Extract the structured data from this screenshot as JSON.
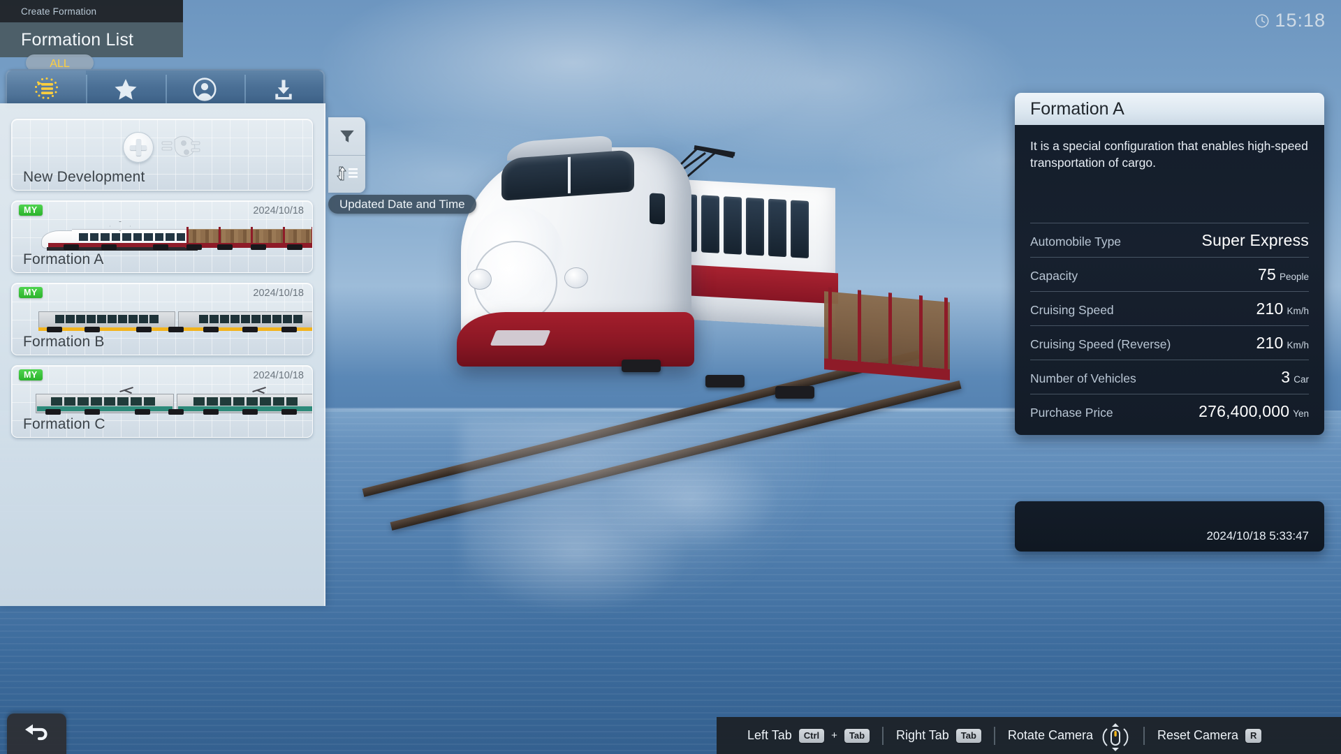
{
  "header": {
    "breadcrumb": "Create Formation",
    "title": "Formation List"
  },
  "clock": {
    "icon": "clock-icon",
    "time": "15:18"
  },
  "tabs": {
    "active_pill": "ALL",
    "items": [
      {
        "icon": "list-all-icon",
        "name": "tab-all",
        "active": true
      },
      {
        "icon": "star-icon",
        "name": "tab-favorites",
        "active": false
      },
      {
        "icon": "person-icon",
        "name": "tab-user",
        "active": false
      },
      {
        "icon": "download-icon",
        "name": "tab-download",
        "active": false
      }
    ]
  },
  "list": {
    "new_development": {
      "label": "New Development",
      "plus_icon": "plus-icon",
      "wrench_icon": "wrench-icon"
    },
    "cards": [
      {
        "badge": "MY",
        "date": "2024/10/18",
        "name": "Formation A",
        "thumb": "shinkansen-freight"
      },
      {
        "badge": "MY",
        "date": "2024/10/18",
        "name": "Formation B",
        "thumb": "diesel-commuter"
      },
      {
        "badge": "MY",
        "date": "2024/10/18",
        "name": "Formation C",
        "thumb": "green-commuter"
      }
    ]
  },
  "side_buttons": {
    "filter": {
      "icon": "filter-funnel-icon"
    },
    "sort": {
      "icon": "sort-icon"
    },
    "tooltip": "Updated Date and Time"
  },
  "back_button": {
    "icon": "back-arrow-icon"
  },
  "info_panel": {
    "title": "Formation A",
    "description": "It is a special configuration that enables high-speed transportation of cargo.",
    "stats": [
      {
        "key": "Automobile Type",
        "value": "Super Express",
        "unit": ""
      },
      {
        "key": "Capacity",
        "value": "75",
        "unit": "People"
      },
      {
        "key": "Cruising Speed",
        "value": "210",
        "unit": "Km/h"
      },
      {
        "key": "Cruising Speed (Reverse)",
        "value": "210",
        "unit": "Km/h"
      },
      {
        "key": "Number of Vehicles",
        "value": "3",
        "unit": "Car"
      },
      {
        "key": "Purchase Price",
        "value": "276,400,000",
        "unit": "Yen"
      }
    ]
  },
  "timestamp_panel": {
    "timestamp": "2024/10/18 5:33:47"
  },
  "hints": [
    {
      "label": "Left Tab",
      "keys": [
        "Ctrl",
        "Tab"
      ],
      "joiner": "+"
    },
    {
      "label": "Right Tab",
      "keys": [
        "Tab"
      ],
      "joiner": ""
    },
    {
      "label": "Rotate Camera",
      "icon": "mouse-rotate-icon"
    },
    {
      "label": "Reset Camera",
      "keys": [
        "R"
      ],
      "joiner": ""
    }
  ],
  "colors": {
    "accent_yellow": "#ffcf3d",
    "badge_green": "#2bb32b",
    "panel_dark": "#141e2b",
    "train_red": "#8f1d2a"
  }
}
